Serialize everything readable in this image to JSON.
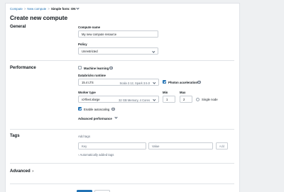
{
  "breadcrumb": {
    "items": [
      "Compute",
      "New compute"
    ],
    "separator": ">",
    "form_mode": "Simple form: ON"
  },
  "title": "Create new compute",
  "general": {
    "section_title": "General",
    "compute_name_label": "Compute name",
    "compute_name_value": "My new compute resource",
    "policy_label": "Policy",
    "policy_value": "Unrestricted"
  },
  "performance": {
    "section_title": "Performance",
    "machine_learning_label": "Machine learning",
    "machine_learning_checked": false,
    "runtime_label": "Databricks runtime",
    "runtime_value": "15.4 LTS",
    "runtime_meta": "Scala 2.12, Spark 3.5.0",
    "photon_label": "Photon acceleration",
    "photon_checked": true,
    "worker_type_label": "Worker type",
    "worker_type_value": "rd-fleet.xlarge",
    "worker_type_meta": "32 GB Memory, 4 Cores",
    "min_label": "Min",
    "min_value": "1",
    "max_label": "Max",
    "max_value": "2",
    "single_node_label": "Single node",
    "autoscaling_label": "Enable autoscaling",
    "autoscaling_checked": true,
    "advanced_performance_label": "Advanced performance"
  },
  "tags": {
    "section_title": "Tags",
    "add_tags_label": "Add tags",
    "key_placeholder": "Key",
    "value_placeholder": "Value",
    "add_button": "Add",
    "auto_added_label": "Automatically added tags"
  },
  "advanced": {
    "section_title": "Advanced"
  },
  "colors": {
    "accent": "#2272b4",
    "border": "#c9ced4",
    "muted_text": "#5f6b7a"
  }
}
